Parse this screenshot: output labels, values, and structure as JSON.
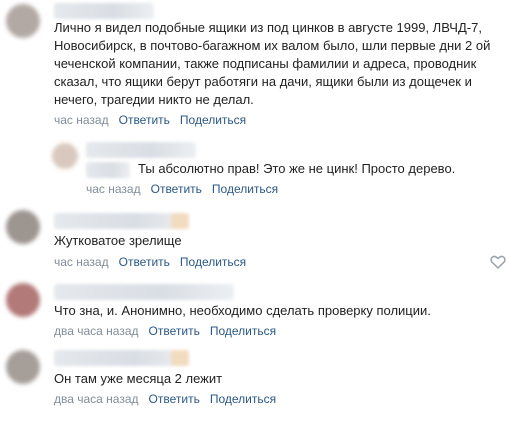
{
  "comments": [
    {
      "text_lines": [
        "Лично я видел подобные ящики из под цинков в августе 1999, ЛВЧД-7,",
        "Новосибирск, в почтово-багажном их валом было, шли первые дни 2 ой",
        "чеченской компании, также подписаны фамилии и адреса, проводник",
        "сказал, что ящики берут работяги на дачи, ящики были из дощечек и",
        "нечего, трагедии никто не делал."
      ],
      "time": "час назад",
      "reply_label": "Ответить",
      "share_label": "Поделиться"
    },
    {
      "text_lines": [
        "Ты абсолютно прав! Это же не цинк! Просто дерево."
      ],
      "time": "час назад",
      "reply_label": "Ответить",
      "share_label": "Поделиться"
    },
    {
      "text_lines": [
        "Жутковатое зрелище"
      ],
      "time": "час назад",
      "reply_label": "Ответить",
      "share_label": "Поделиться"
    },
    {
      "text_lines": [
        "Что зна, и. Анонимно, необходимо сделать проверку полиции."
      ],
      "time": "два часа назад",
      "reply_label": "Ответить",
      "share_label": "Поделиться"
    },
    {
      "text_lines": [
        "Он там уже месяца 2 лежит"
      ],
      "time": "два часа назад",
      "reply_label": "Ответить",
      "share_label": "Поделиться"
    }
  ],
  "icons": {
    "like": "heart-icon"
  },
  "colors": {
    "link": "#2a5885",
    "meta": "#818c99",
    "text": "#222222"
  }
}
